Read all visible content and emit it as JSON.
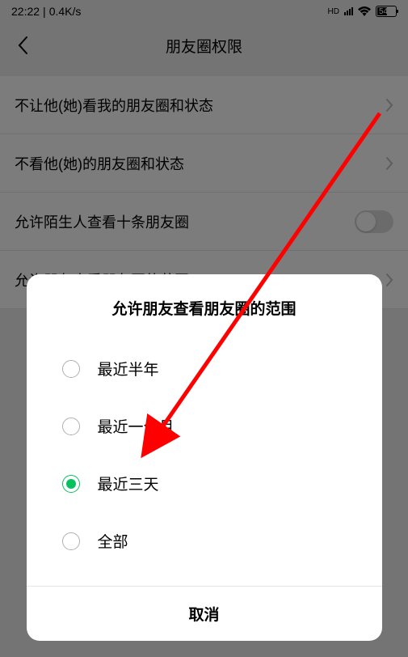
{
  "status_bar": {
    "time": "22:22",
    "speed": "0.4K/s",
    "hd_label": "HD",
    "battery_percent": "54"
  },
  "header": {
    "title": "朋友圈权限"
  },
  "settings": [
    {
      "label": "不让他(她)看我的朋友圈和状态",
      "type": "chevron"
    },
    {
      "label": "不看他(她)的朋友圈和状态",
      "type": "chevron"
    },
    {
      "label": "允许陌生人查看十条朋友圈",
      "type": "toggle"
    },
    {
      "label": "允许朋友查看朋友圈的范围",
      "type": "chevron"
    }
  ],
  "sheet": {
    "title": "允许朋友查看朋友圈的范围",
    "options": [
      {
        "label": "最近半年",
        "selected": false
      },
      {
        "label": "最近一个月",
        "selected": false
      },
      {
        "label": "最近三天",
        "selected": true
      },
      {
        "label": "全部",
        "selected": false
      }
    ],
    "cancel": "取消"
  },
  "colors": {
    "accent": "#07c160",
    "arrow": "#ff0000"
  }
}
